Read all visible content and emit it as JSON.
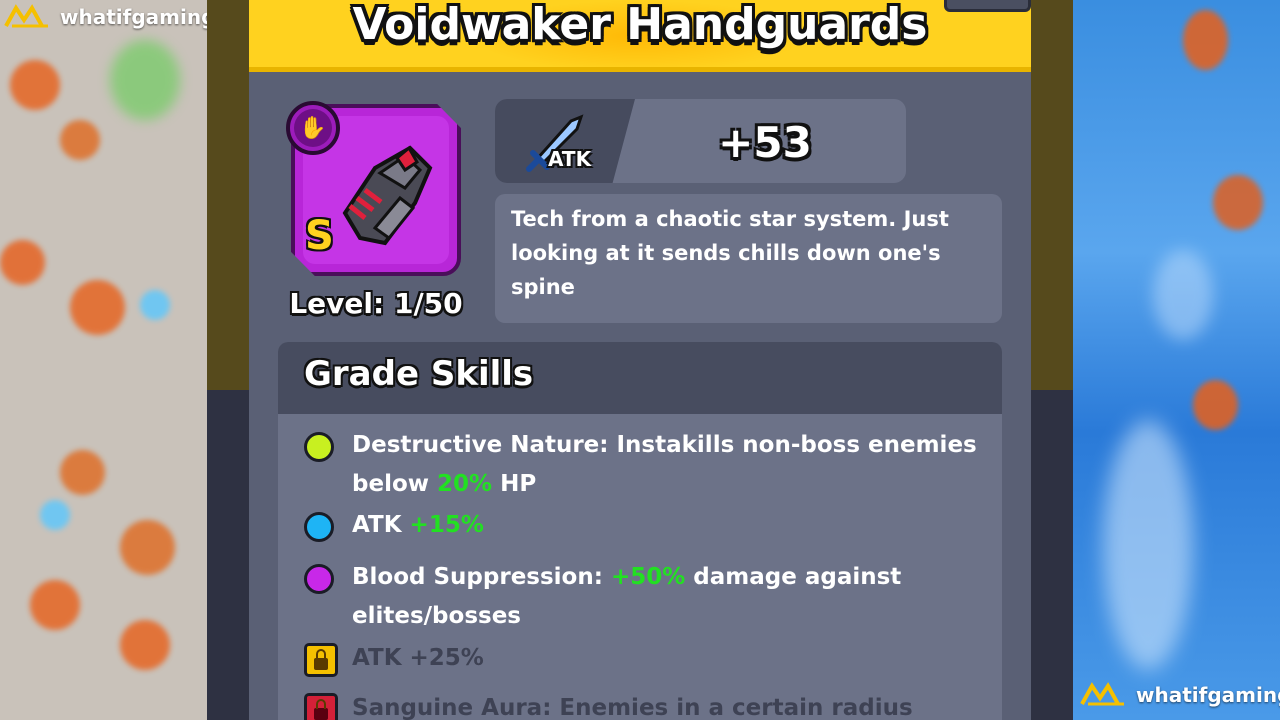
{
  "watermark": {
    "brand": "whatifgaming"
  },
  "item": {
    "name": "Voidwaker Handguards",
    "grade": "S",
    "level_label": "Level: 1/50",
    "slot_icon": "glove-icon",
    "image": "gauntlet-icon"
  },
  "stat": {
    "icon": "sword-icon",
    "label": "ATK",
    "value": "+53"
  },
  "description": "Tech from a chaotic star system. Just looking at it sends chills down one's spine",
  "grade_skills": {
    "title": "Grade Skills",
    "skills": [
      {
        "color": "#c8f020",
        "locked": false,
        "parts": [
          "Destructive Nature: Instakills non-boss enemies below ",
          "20%",
          " HP"
        ]
      },
      {
        "color": "#1eb4f5",
        "locked": false,
        "parts": [
          "ATK ",
          "+15%",
          ""
        ]
      },
      {
        "color": "#c828e8",
        "locked": false,
        "parts": [
          "Blood Suppression: ",
          "+50%",
          " damage against elites/bosses"
        ]
      },
      {
        "color": "#f5c000",
        "locked": true,
        "parts": [
          "ATK +25%"
        ]
      },
      {
        "color": "#d42038",
        "locked": true,
        "parts": [
          "Sanguine Aura: Enemies in a certain radius"
        ]
      }
    ]
  },
  "colors": {
    "header_gold": "#ffd21f",
    "panel": "#6c7288",
    "highlight_green": "#22e022"
  }
}
